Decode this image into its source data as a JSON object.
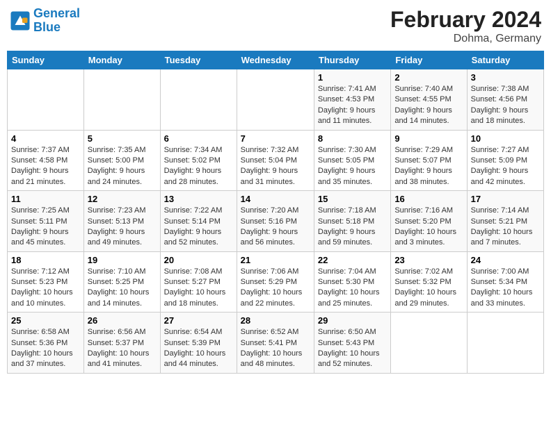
{
  "header": {
    "logo_line1": "General",
    "logo_line2": "Blue",
    "title": "February 2024",
    "subtitle": "Dohma, Germany"
  },
  "days_of_week": [
    "Sunday",
    "Monday",
    "Tuesday",
    "Wednesday",
    "Thursday",
    "Friday",
    "Saturday"
  ],
  "weeks": [
    [
      {
        "day": "",
        "sunrise": "",
        "sunset": "",
        "daylight": ""
      },
      {
        "day": "",
        "sunrise": "",
        "sunset": "",
        "daylight": ""
      },
      {
        "day": "",
        "sunrise": "",
        "sunset": "",
        "daylight": ""
      },
      {
        "day": "",
        "sunrise": "",
        "sunset": "",
        "daylight": ""
      },
      {
        "day": "1",
        "sunrise": "Sunrise: 7:41 AM",
        "sunset": "Sunset: 4:53 PM",
        "daylight": "Daylight: 9 hours and 11 minutes."
      },
      {
        "day": "2",
        "sunrise": "Sunrise: 7:40 AM",
        "sunset": "Sunset: 4:55 PM",
        "daylight": "Daylight: 9 hours and 14 minutes."
      },
      {
        "day": "3",
        "sunrise": "Sunrise: 7:38 AM",
        "sunset": "Sunset: 4:56 PM",
        "daylight": "Daylight: 9 hours and 18 minutes."
      }
    ],
    [
      {
        "day": "4",
        "sunrise": "Sunrise: 7:37 AM",
        "sunset": "Sunset: 4:58 PM",
        "daylight": "Daylight: 9 hours and 21 minutes."
      },
      {
        "day": "5",
        "sunrise": "Sunrise: 7:35 AM",
        "sunset": "Sunset: 5:00 PM",
        "daylight": "Daylight: 9 hours and 24 minutes."
      },
      {
        "day": "6",
        "sunrise": "Sunrise: 7:34 AM",
        "sunset": "Sunset: 5:02 PM",
        "daylight": "Daylight: 9 hours and 28 minutes."
      },
      {
        "day": "7",
        "sunrise": "Sunrise: 7:32 AM",
        "sunset": "Sunset: 5:04 PM",
        "daylight": "Daylight: 9 hours and 31 minutes."
      },
      {
        "day": "8",
        "sunrise": "Sunrise: 7:30 AM",
        "sunset": "Sunset: 5:05 PM",
        "daylight": "Daylight: 9 hours and 35 minutes."
      },
      {
        "day": "9",
        "sunrise": "Sunrise: 7:29 AM",
        "sunset": "Sunset: 5:07 PM",
        "daylight": "Daylight: 9 hours and 38 minutes."
      },
      {
        "day": "10",
        "sunrise": "Sunrise: 7:27 AM",
        "sunset": "Sunset: 5:09 PM",
        "daylight": "Daylight: 9 hours and 42 minutes."
      }
    ],
    [
      {
        "day": "11",
        "sunrise": "Sunrise: 7:25 AM",
        "sunset": "Sunset: 5:11 PM",
        "daylight": "Daylight: 9 hours and 45 minutes."
      },
      {
        "day": "12",
        "sunrise": "Sunrise: 7:23 AM",
        "sunset": "Sunset: 5:13 PM",
        "daylight": "Daylight: 9 hours and 49 minutes."
      },
      {
        "day": "13",
        "sunrise": "Sunrise: 7:22 AM",
        "sunset": "Sunset: 5:14 PM",
        "daylight": "Daylight: 9 hours and 52 minutes."
      },
      {
        "day": "14",
        "sunrise": "Sunrise: 7:20 AM",
        "sunset": "Sunset: 5:16 PM",
        "daylight": "Daylight: 9 hours and 56 minutes."
      },
      {
        "day": "15",
        "sunrise": "Sunrise: 7:18 AM",
        "sunset": "Sunset: 5:18 PM",
        "daylight": "Daylight: 9 hours and 59 minutes."
      },
      {
        "day": "16",
        "sunrise": "Sunrise: 7:16 AM",
        "sunset": "Sunset: 5:20 PM",
        "daylight": "Daylight: 10 hours and 3 minutes."
      },
      {
        "day": "17",
        "sunrise": "Sunrise: 7:14 AM",
        "sunset": "Sunset: 5:21 PM",
        "daylight": "Daylight: 10 hours and 7 minutes."
      }
    ],
    [
      {
        "day": "18",
        "sunrise": "Sunrise: 7:12 AM",
        "sunset": "Sunset: 5:23 PM",
        "daylight": "Daylight: 10 hours and 10 minutes."
      },
      {
        "day": "19",
        "sunrise": "Sunrise: 7:10 AM",
        "sunset": "Sunset: 5:25 PM",
        "daylight": "Daylight: 10 hours and 14 minutes."
      },
      {
        "day": "20",
        "sunrise": "Sunrise: 7:08 AM",
        "sunset": "Sunset: 5:27 PM",
        "daylight": "Daylight: 10 hours and 18 minutes."
      },
      {
        "day": "21",
        "sunrise": "Sunrise: 7:06 AM",
        "sunset": "Sunset: 5:29 PM",
        "daylight": "Daylight: 10 hours and 22 minutes."
      },
      {
        "day": "22",
        "sunrise": "Sunrise: 7:04 AM",
        "sunset": "Sunset: 5:30 PM",
        "daylight": "Daylight: 10 hours and 25 minutes."
      },
      {
        "day": "23",
        "sunrise": "Sunrise: 7:02 AM",
        "sunset": "Sunset: 5:32 PM",
        "daylight": "Daylight: 10 hours and 29 minutes."
      },
      {
        "day": "24",
        "sunrise": "Sunrise: 7:00 AM",
        "sunset": "Sunset: 5:34 PM",
        "daylight": "Daylight: 10 hours and 33 minutes."
      }
    ],
    [
      {
        "day": "25",
        "sunrise": "Sunrise: 6:58 AM",
        "sunset": "Sunset: 5:36 PM",
        "daylight": "Daylight: 10 hours and 37 minutes."
      },
      {
        "day": "26",
        "sunrise": "Sunrise: 6:56 AM",
        "sunset": "Sunset: 5:37 PM",
        "daylight": "Daylight: 10 hours and 41 minutes."
      },
      {
        "day": "27",
        "sunrise": "Sunrise: 6:54 AM",
        "sunset": "Sunset: 5:39 PM",
        "daylight": "Daylight: 10 hours and 44 minutes."
      },
      {
        "day": "28",
        "sunrise": "Sunrise: 6:52 AM",
        "sunset": "Sunset: 5:41 PM",
        "daylight": "Daylight: 10 hours and 48 minutes."
      },
      {
        "day": "29",
        "sunrise": "Sunrise: 6:50 AM",
        "sunset": "Sunset: 5:43 PM",
        "daylight": "Daylight: 10 hours and 52 minutes."
      },
      {
        "day": "",
        "sunrise": "",
        "sunset": "",
        "daylight": ""
      },
      {
        "day": "",
        "sunrise": "",
        "sunset": "",
        "daylight": ""
      }
    ]
  ]
}
